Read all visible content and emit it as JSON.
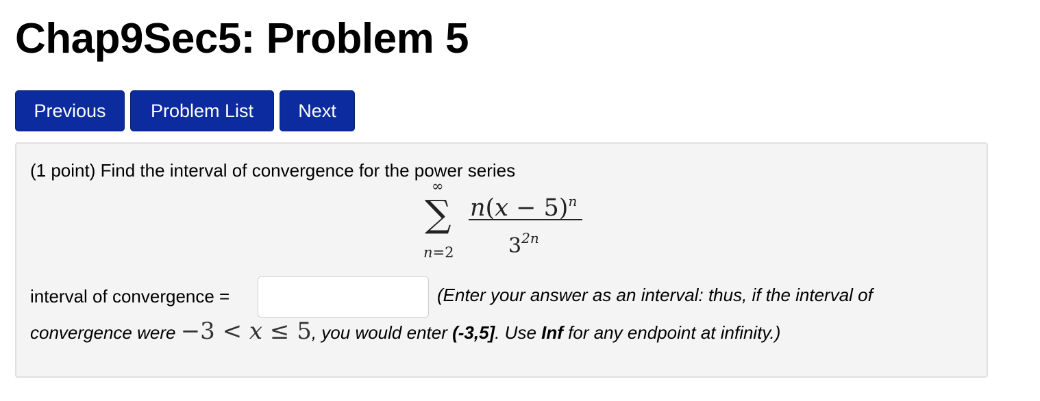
{
  "header": {
    "title": "Chap9Sec5: Problem 5"
  },
  "nav": {
    "previous_label": "Previous",
    "problem_list_label": "Problem List",
    "next_label": "Next",
    "button_color": "#0b2b9e"
  },
  "problem": {
    "intro": "(1 point) Find the interval of convergence for the power series",
    "series": {
      "sigma": "∑",
      "upper_limit": "∞",
      "index_var": "n",
      "lower_eq": "=2",
      "numerator_base": "n(",
      "numerator_var": "x",
      "numerator_rest": " − 5)",
      "numerator_exp": "n",
      "denominator_base": "3",
      "denominator_exp": "2n"
    },
    "answer_label": "interval of convergence =",
    "answer_value": "",
    "hint_line1": "(Enter your answer as an interval: thus, if the interval of",
    "hint_line2_a": "convergence were ",
    "hint_example_math_a": "−3 < ",
    "hint_example_var": "x",
    "hint_example_math_b": " ≤ 5",
    "hint_line2_b": ", you would enter ",
    "hint_example_answer": "(-3,5]",
    "hint_line2_c": ". Use ",
    "hint_inf": "Inf",
    "hint_line2_d": " for any endpoint at infinity.)"
  },
  "colors": {
    "box_background": "#f4f4f4",
    "box_border": "#e0e0e0"
  }
}
